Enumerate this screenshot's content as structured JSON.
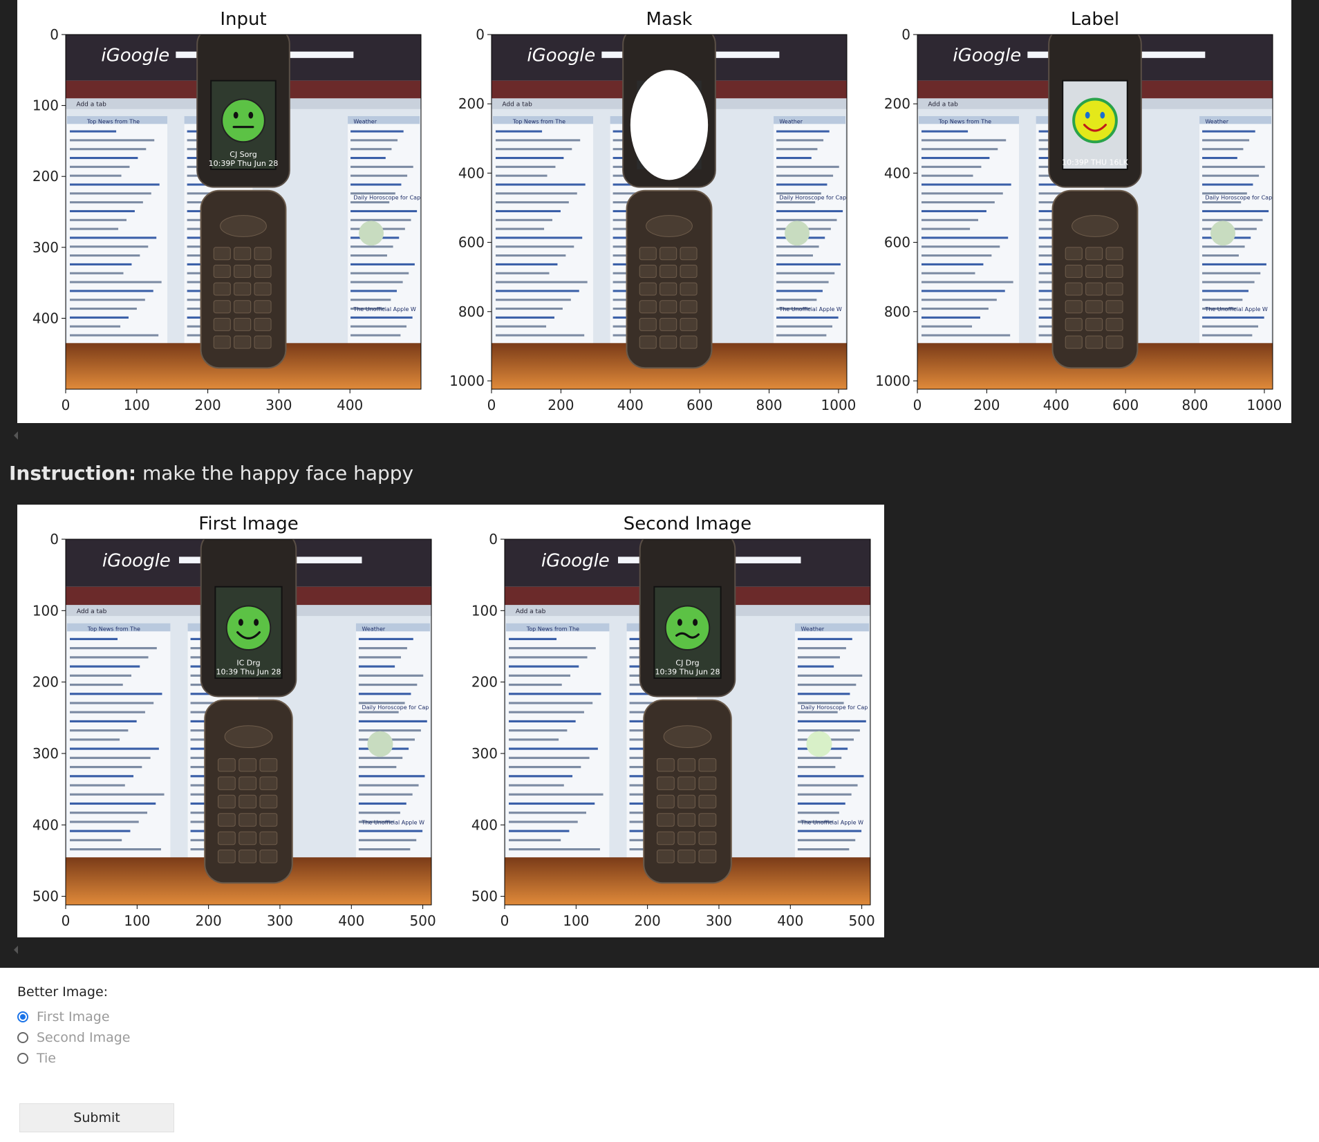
{
  "top_figure": {
    "plots": [
      {
        "title": "Input",
        "x_ticks": [
          "0",
          "100",
          "200",
          "300",
          "400"
        ],
        "y_ticks": [
          "0",
          "100",
          "200",
          "300",
          "400"
        ],
        "xlim": [
          0,
          500
        ],
        "ylim": [
          0,
          500
        ]
      },
      {
        "title": "Mask",
        "x_ticks": [
          "0",
          "200",
          "400",
          "600",
          "800",
          "1000"
        ],
        "y_ticks": [
          "0",
          "200",
          "400",
          "600",
          "800",
          "1000"
        ],
        "xlim": [
          0,
          1024
        ],
        "ylim": [
          0,
          1024
        ]
      },
      {
        "title": "Label",
        "x_ticks": [
          "0",
          "200",
          "400",
          "600",
          "800",
          "1000"
        ],
        "y_ticks": [
          "0",
          "200",
          "400",
          "600",
          "800",
          "1000"
        ],
        "xlim": [
          0,
          1024
        ],
        "ylim": [
          0,
          1024
        ]
      }
    ]
  },
  "instruction": {
    "label": "Instruction:",
    "text": "make the happy face happy"
  },
  "bottom_figure": {
    "plots": [
      {
        "title": "First Image",
        "x_ticks": [
          "0",
          "100",
          "200",
          "300",
          "400",
          "500"
        ],
        "y_ticks": [
          "0",
          "100",
          "200",
          "300",
          "400",
          "500"
        ],
        "xlim": [
          0,
          512
        ],
        "ylim": [
          0,
          512
        ]
      },
      {
        "title": "Second Image",
        "x_ticks": [
          "0",
          "100",
          "200",
          "300",
          "400",
          "500"
        ],
        "y_ticks": [
          "0",
          "100",
          "200",
          "300",
          "400",
          "500"
        ],
        "xlim": [
          0,
          512
        ],
        "ylim": [
          0,
          512
        ]
      }
    ]
  },
  "photo_text": {
    "brand": "iGoogle",
    "add_tab": "Add a tab",
    "weather": "Weather",
    "horoscope": "Daily Horoscope for Cap",
    "apple": "The Unofficial Apple W",
    "news": "Top News from The",
    "phone_input": [
      "CJ Sorg",
      "10:39P Thu Jun 28"
    ],
    "phone_label": "10:39P THU 16LK",
    "phone_first": [
      "IC Drg",
      "10:39 Thu Jun 28"
    ],
    "phone_second": [
      "CJ Drg",
      "10:39 Thu Jun 28"
    ]
  },
  "form": {
    "label": "Better Image:",
    "options": [
      "First Image",
      "Second Image",
      "Tie"
    ],
    "selected": "First Image",
    "submit": "Submit"
  },
  "colors": {
    "dark_bg": "#212121",
    "accent": "#1a73e8",
    "panel_bg": "#ffffff"
  }
}
